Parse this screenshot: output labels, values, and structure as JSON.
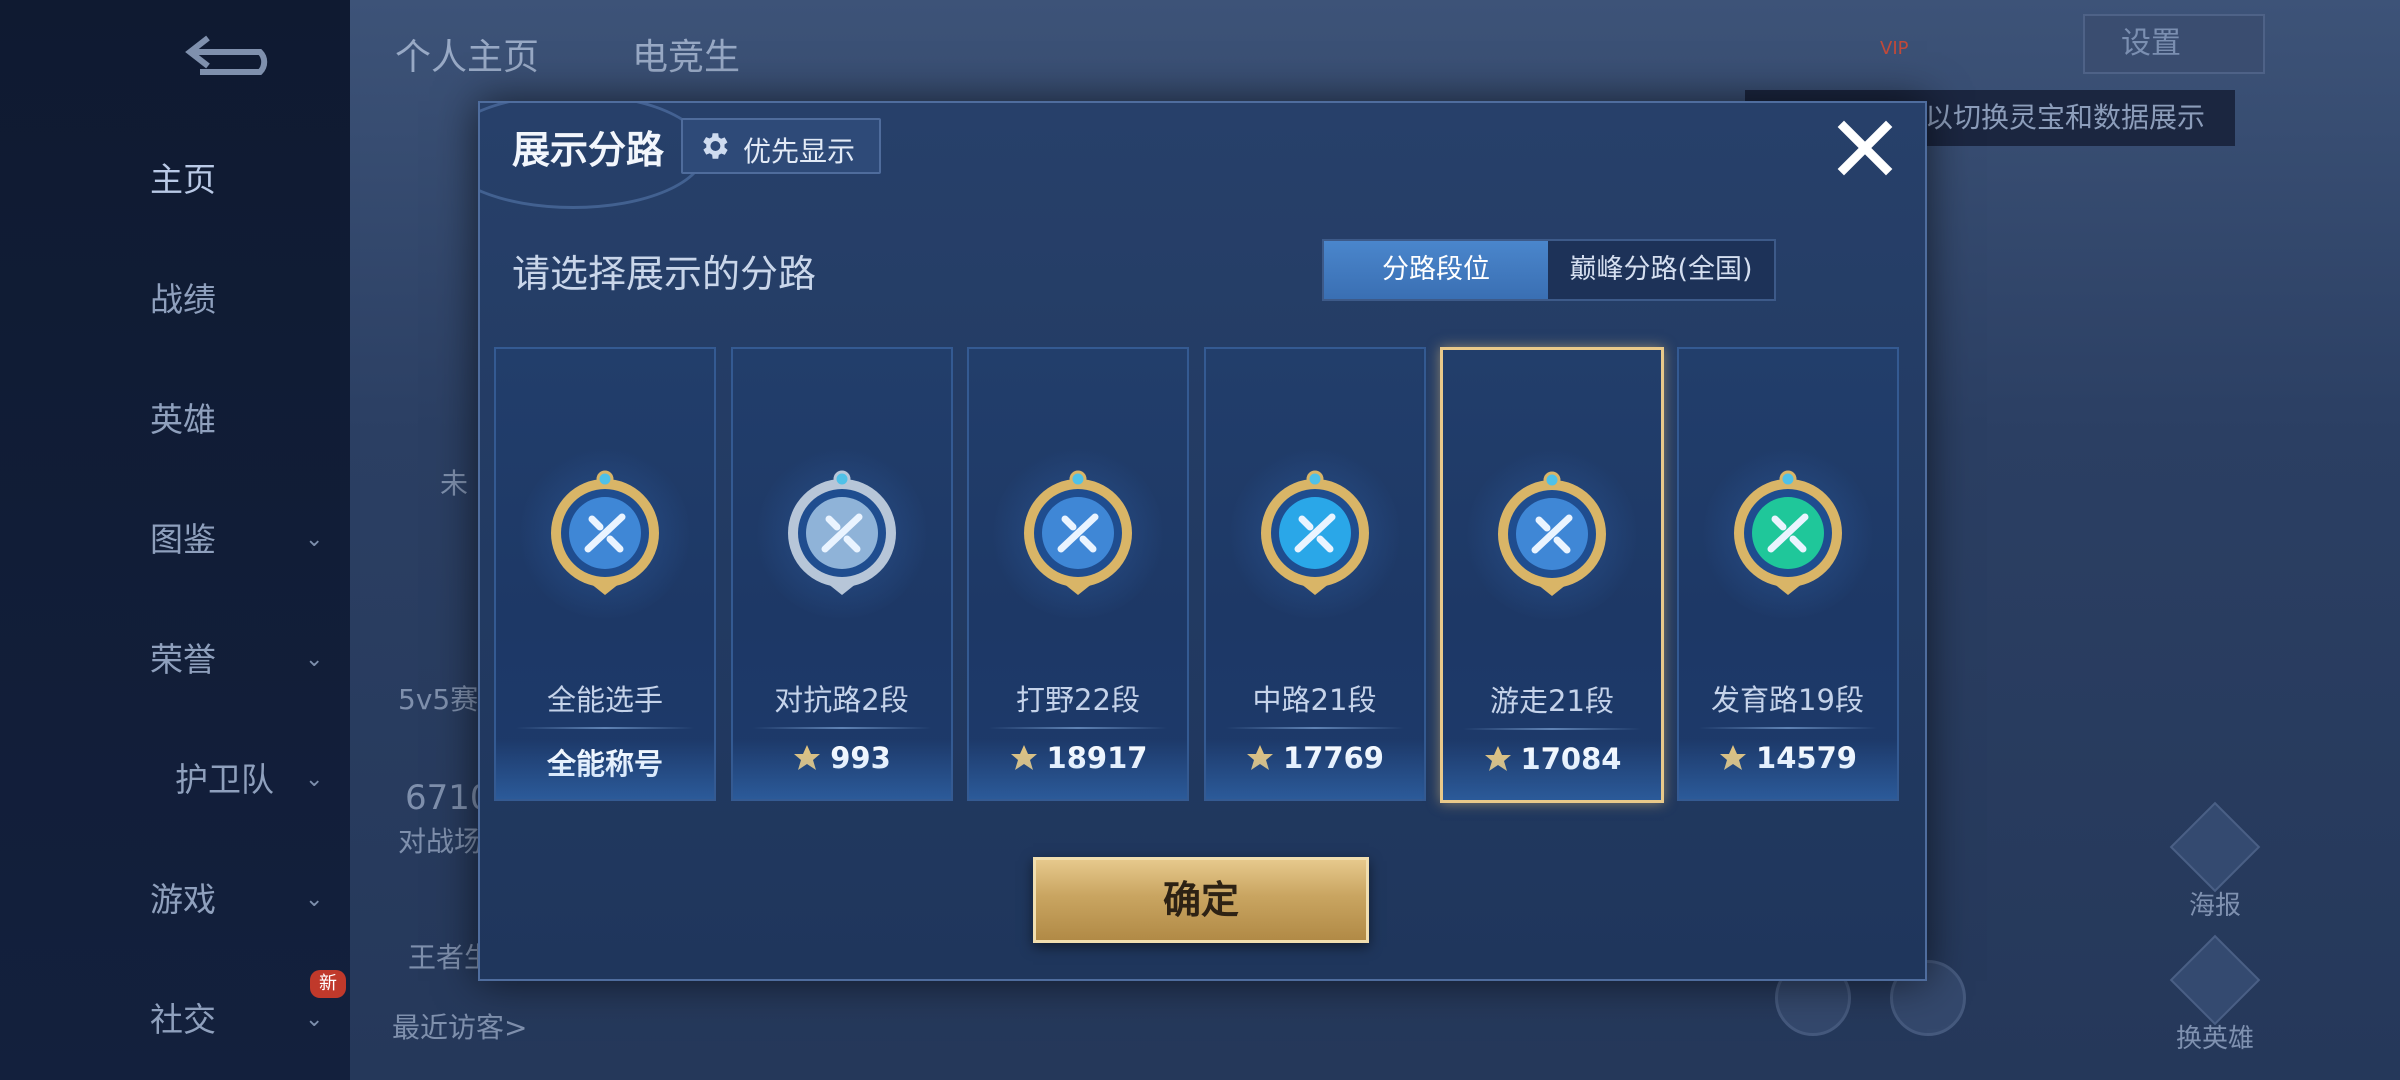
{
  "background": {
    "tabs": [
      "个人主页",
      "电竞生"
    ],
    "sidebar": [
      {
        "label": "主页",
        "has_chevron": false
      },
      {
        "label": "战绩",
        "has_chevron": false
      },
      {
        "label": "英雄",
        "has_chevron": false
      },
      {
        "label": "图鉴",
        "has_chevron": true
      },
      {
        "label": "荣誉",
        "has_chevron": true
      },
      {
        "label": "护卫队",
        "has_chevron": true
      },
      {
        "label": "游戏",
        "has_chevron": true
      },
      {
        "label": "社交",
        "has_chevron": true
      }
    ],
    "new_badge": "新",
    "setting_label": "设置",
    "tooltip": "以切换灵宝和数据展示",
    "texts": {
      "unknown": "未",
      "mode": "5v5赛",
      "count": "6710",
      "arena": "对战场",
      "king": "王者生",
      "recent_visitors": "最近访客>"
    },
    "right_buttons": [
      "海报",
      "换英雄"
    ],
    "vip": "VIP"
  },
  "dialog": {
    "title": "展示分路",
    "priority_label": "优先显示",
    "subtitle": "请选择展示的分路",
    "toggle": {
      "active": "分路段位",
      "inactive": "巅峰分路(全国)"
    },
    "confirm_label": "确定",
    "cards": [
      {
        "name": "全能选手",
        "stat": "全能称号",
        "has_points_icon": false,
        "selected": false,
        "accent": "#3f87d6"
      },
      {
        "name": "对抗路2段",
        "stat": "993",
        "has_points_icon": true,
        "selected": false,
        "accent": "#8fb3d8"
      },
      {
        "name": "打野22段",
        "stat": "18917",
        "has_points_icon": true,
        "selected": false,
        "accent": "#3f87d6"
      },
      {
        "name": "中路21段",
        "stat": "17769",
        "has_points_icon": true,
        "selected": false,
        "accent": "#2aa7e8"
      },
      {
        "name": "游走21段",
        "stat": "17084",
        "has_points_icon": true,
        "selected": true,
        "accent": "#3f87d6"
      },
      {
        "name": "发育路19段",
        "stat": "14579",
        "has_points_icon": true,
        "selected": false,
        "accent": "#1fc79a"
      }
    ]
  },
  "colors": {
    "gold": "#e9c98a",
    "confirm_gold": "#c9a561",
    "toggle_active": "#3a6fb3"
  }
}
